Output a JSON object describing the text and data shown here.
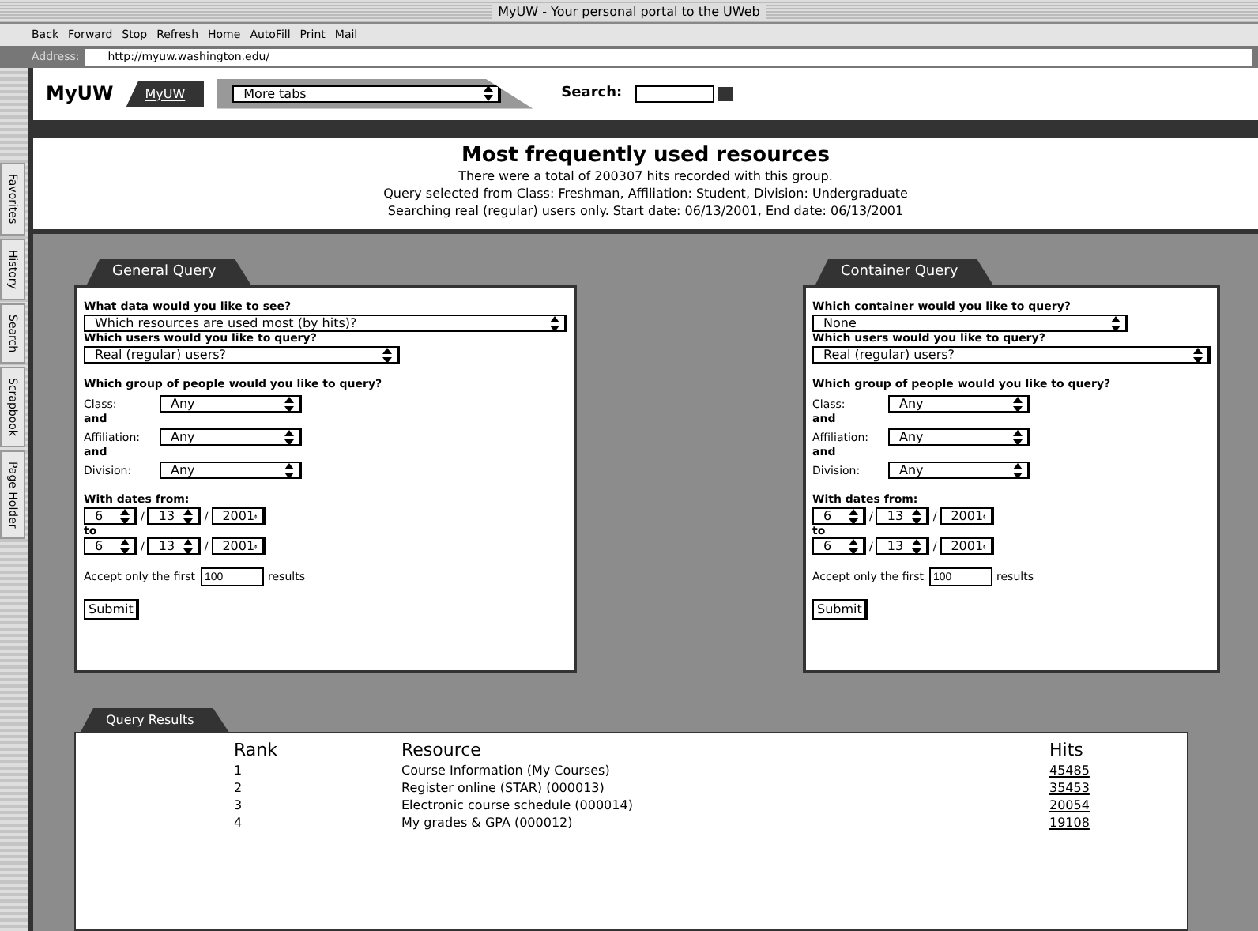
{
  "window": {
    "title": "MyUW - Your personal portal to the UWeb"
  },
  "toolbar": {
    "buttons": [
      "Back",
      "Forward",
      "Stop",
      "Refresh",
      "Home",
      "AutoFill",
      "Print",
      "Mail"
    ]
  },
  "address_bar": {
    "label": "Address:",
    "value": "http://myuw.washington.edu/"
  },
  "header": {
    "logo": "MyUW",
    "tab": "MyUW",
    "tabs_select": "More tabs",
    "search_label": "Search:"
  },
  "sidebar": {
    "tabs": [
      "Favorites",
      "History",
      "Search",
      "Scrapbook",
      "Page Holder"
    ]
  },
  "summary": {
    "title": "Most frequently used resources",
    "lines": [
      "There were a total of 200307 hits recorded with this group.",
      "Query selected from Class: Freshman, Affiliation: Student, Division: Undergraduate",
      "Searching real (regular) users only. Start date: 06/13/2001, End date: 06/13/2001"
    ]
  },
  "panels": [
    {
      "title": "General Query",
      "questions": [
        {
          "label": "What data would you like to see?",
          "select": "Which resources are used most (by hits)?",
          "wide": true
        },
        {
          "label": "Which users would you like to query?",
          "select": "Real (regular) users?",
          "wide": false
        }
      ],
      "group_label": "Which group of people would you like to query?",
      "filters": [
        {
          "label": "Class:",
          "value": "Any",
          "joiner": "and"
        },
        {
          "label": "Affiliation:",
          "value": "Any",
          "joiner": "and"
        },
        {
          "label": "Division:",
          "value": "Any"
        }
      ],
      "dates": {
        "label": "With dates from:",
        "from": [
          "6",
          "13",
          "2001"
        ],
        "to_label": "to",
        "to": [
          "6",
          "13",
          "2001"
        ],
        "separator": "/"
      },
      "limit": {
        "before": "Accept only the first",
        "value": "100",
        "after": "results"
      },
      "submit": "Submit"
    },
    {
      "title": "Container Query",
      "questions": [
        {
          "label": "Which container would you like to query?",
          "select": "None",
          "wide": false
        },
        {
          "label": "Which users would you like to query?",
          "select": "Real (regular) users?",
          "wide": true
        }
      ],
      "group_label": "Which group of people would you like to query?",
      "filters": [
        {
          "label": "Class:",
          "value": "Any",
          "joiner": "and"
        },
        {
          "label": "Affiliation:",
          "value": "Any",
          "joiner": "and"
        },
        {
          "label": "Division:",
          "value": "Any"
        }
      ],
      "dates": {
        "label": "With dates from:",
        "from": [
          "6",
          "13",
          "2001"
        ],
        "to_label": "to",
        "to": [
          "6",
          "13",
          "2001"
        ],
        "separator": "/"
      },
      "limit": {
        "before": "Accept only the first",
        "value": "100",
        "after": "results"
      },
      "submit": "Submit"
    }
  ],
  "results": {
    "title": "Query Results",
    "columns": [
      "Rank",
      "Resource",
      "Hits"
    ],
    "rows": [
      {
        "rank": "1",
        "resource": "Course Information (My Courses)",
        "hits": "45485"
      },
      {
        "rank": "2",
        "resource": "Register online (STAR) (000013)",
        "hits": "35453"
      },
      {
        "rank": "3",
        "resource": "Electronic course schedule (000014)",
        "hits": "20054"
      },
      {
        "rank": "4",
        "resource": "My grades & GPA (000012)",
        "hits": "19108"
      }
    ]
  }
}
